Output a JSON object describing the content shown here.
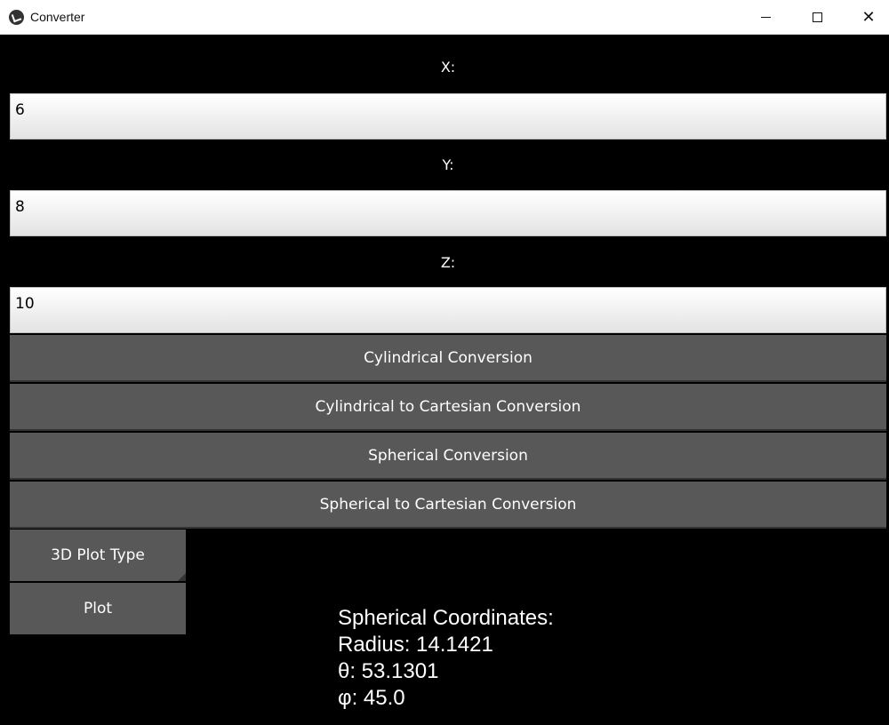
{
  "window": {
    "title": "Converter"
  },
  "fields": {
    "x": {
      "label": "X:",
      "value": "6"
    },
    "y": {
      "label": "Y:",
      "value": "8"
    },
    "z": {
      "label": "Z:",
      "value": "10"
    }
  },
  "buttons": {
    "cylindrical": "Cylindrical Conversion",
    "cyl_to_cart": "Cylindrical to Cartesian Conversion",
    "spherical": "Spherical Conversion",
    "sph_to_cart": "Spherical to Cartesian Conversion",
    "plot_type": "3D Plot Type",
    "plot": "Plot"
  },
  "result": {
    "heading": "Spherical Coordinates:",
    "radius": "Radius: 14.1421",
    "theta": "θ: 53.1301",
    "phi": "φ: 45.0"
  },
  "icons": {
    "app": "app-icon",
    "minimize": "minimize-icon",
    "maximize": "maximize-icon",
    "close": "close-icon"
  }
}
